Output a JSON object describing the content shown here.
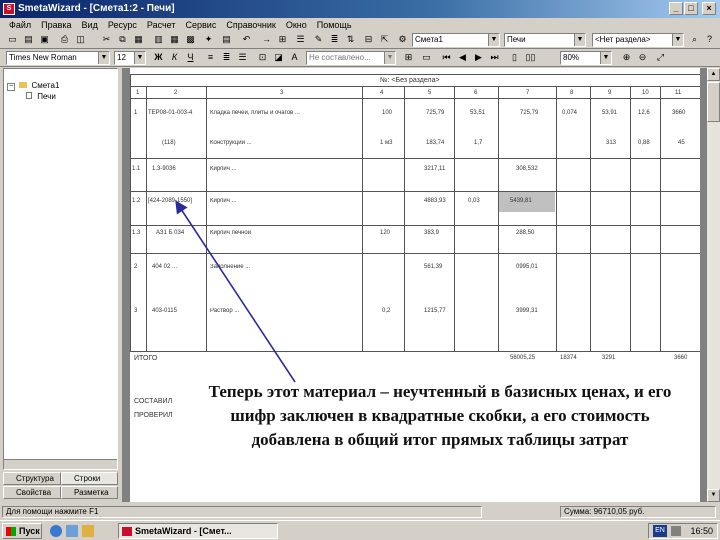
{
  "window": {
    "title": "SmetaWizard - [Смета1:2 - Печи]"
  },
  "menu": [
    "Файл",
    "Правка",
    "Вид",
    "Ресурс",
    "Расчет",
    "Сервис",
    "Справочник",
    "Окно",
    "Помощь"
  ],
  "toolbar": {
    "estimate_combo": "Смета1",
    "section_combo": "Печи",
    "no_section_combo": "<Нет раздела>",
    "font_combo": "Times New Roman",
    "size_combo": "12",
    "style_combo": "Не составлено...",
    "zoom_combo": "80%"
  },
  "tree": {
    "root": "Смета1",
    "child": "Печи"
  },
  "panel_tabs": [
    "Структура",
    "Строки",
    "Свойства",
    "Разметка"
  ],
  "doc": {
    "section_header": "№: <Без раздела>",
    "col_numbers": [
      "1",
      "2",
      "3",
      "4",
      "5",
      "6",
      "7",
      "8",
      "9",
      "10",
      "11"
    ],
    "rows": [
      {
        "n": "1",
        "code": "ТЕР08-01-003-4",
        "name": "Кладка печей, плиты и очагов ...",
        "qty": "100",
        "c5": "725,79",
        "c6": "53,51",
        "c7": "725,79",
        "c8": "0,074",
        "c9": "53,91",
        "c10": "12,6",
        "c11": "3660"
      },
      {
        "n": "",
        "code": "(118)",
        "name": "Конструкции ...",
        "qty": "1 м3",
        "c5": "183,74",
        "c6": "1,7",
        "c7": "",
        "c8": "",
        "c9": "313",
        "c10": "0,88",
        "c11": "45"
      },
      {
        "n": "1.1",
        "code": "1.3-9036",
        "name": "Кирпич ...",
        "qty": "",
        "c5": "3217,11",
        "c6": "",
        "c7": "308,532",
        "c8": "",
        "c9": "",
        "c10": "",
        "c11": ""
      },
      {
        "n": "1.2",
        "code": "[424-2089-1550]",
        "name": "Кирпич ...",
        "qty": "",
        "c5": "4883,93",
        "c6": "0,03",
        "c7": "5439,81",
        "c8": "",
        "c9": "",
        "c10": "",
        "c11": ""
      },
      {
        "n": "1.3",
        "code": "АЗ1 Б 034",
        "name": "Кирпич печной",
        "qty": "120",
        "c5": "383,9",
        "c6": "",
        "c7": "288,50",
        "c8": "",
        "c9": "",
        "c10": "",
        "c11": ""
      },
      {
        "n": "2",
        "code": "404 02 ...",
        "name": "Заполнение ...",
        "qty": "",
        "c5": "561,39",
        "c6": "",
        "c7": "0995,01",
        "c8": "",
        "c9": "",
        "c10": "",
        "c11": ""
      },
      {
        "n": "3",
        "code": "403-0115",
        "name": "Раствор ...",
        "qty": "0,2",
        "c5": "1215,77",
        "c6": "",
        "c7": "3999,31",
        "c8": "",
        "c9": "",
        "c10": "",
        "c11": ""
      }
    ],
    "total_label": "ИТОГО",
    "totals": {
      "c7": "56005,25",
      "c8": "18374",
      "c9": "3291",
      "c11": "3660"
    },
    "sign_label_1": "СОСТАВИЛ",
    "sign_label_2": "ПРОВЕРИЛ"
  },
  "caption": "Теперь этот материал – неучтенный в базисных ценах, и его шифр заключен в квадратные скобки, а его стоимость добавлена в общий итог прямых таблицы затрат",
  "status": {
    "left": "Для помощи нажмите F1",
    "right": "Сумма: 96710,05 руб."
  },
  "taskbar": {
    "start": "Пуск",
    "task": "SmetaWizard - [Смет...",
    "clock": "16:50",
    "lang": "EN"
  },
  "colors": {
    "titlebar": "#0a246a",
    "selection": "#c0c0c0",
    "arrow": "#2a2a9a"
  }
}
